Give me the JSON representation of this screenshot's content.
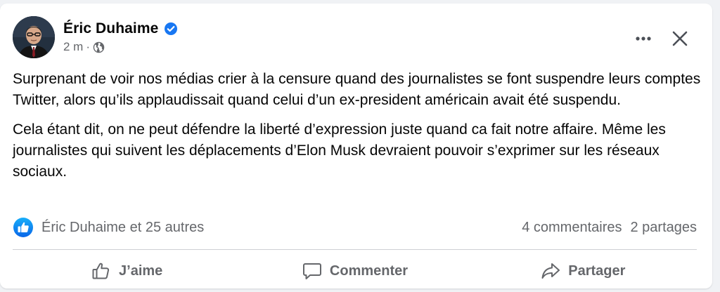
{
  "post": {
    "author": "Éric Duhaime",
    "time": "2 m",
    "separator": "·",
    "paragraphs": [
      "Surprenant de voir nos médias crier à la censure quand des journalistes se font suspendre leurs comptes Twitter, alors qu’ils applaudissait quand celui d’un ex-president américain avait été suspendu.",
      "Cela étant dit, on ne peut défendre la liberté d’expression juste quand ca fait notre affaire. Même les journalistes qui suivent les déplacements d’Elon Musk devraient pouvoir s’exprimer sur les réseaux sociaux."
    ]
  },
  "stats": {
    "reactions_text": "Éric Duhaime et 25 autres",
    "comments": "4 commentaires",
    "shares": "2 partages"
  },
  "actions": {
    "like": "J’aime",
    "comment": "Commenter",
    "share": "Partager"
  },
  "icons": {
    "verified": "verified-badge-icon",
    "audience": "globe-icon",
    "more": "more-options-icon",
    "close": "close-icon",
    "like_reaction": "like-reaction-icon",
    "like_action": "thumbs-up-icon",
    "comment_action": "comment-bubble-icon",
    "share_action": "share-arrow-icon"
  },
  "colors": {
    "accent": "#1877f2",
    "secondary_text": "#65676b",
    "primary_text": "#050505",
    "card_background": "#ffffff",
    "page_background": "#f0f2f5"
  }
}
